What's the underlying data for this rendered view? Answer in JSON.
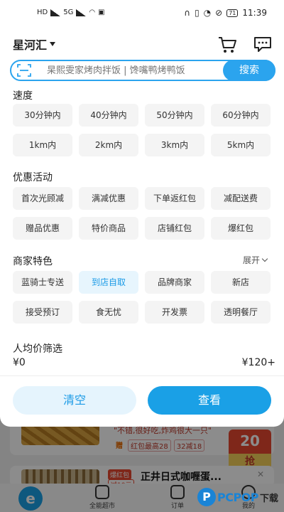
{
  "status_bar": {
    "network": "5G",
    "hd": "HD",
    "battery": "71",
    "time": "11:39"
  },
  "header": {
    "location": "星河汇"
  },
  "search": {
    "placeholder": "杲熙雯家烤肉拌饭 | 馋嘴鸭烤鸭饭",
    "button_label": "搜索"
  },
  "filters": {
    "speed": {
      "title": "速度",
      "options": [
        "30分钟内",
        "40分钟内",
        "50分钟内",
        "60分钟内",
        "1km内",
        "2km内",
        "3km内",
        "5km内"
      ]
    },
    "promotions": {
      "title": "优惠活动",
      "options": [
        "首次光顾减",
        "满减优惠",
        "下单返红包",
        "减配送费",
        "赠品优惠",
        "特价商品",
        "店铺红包",
        "爆红包"
      ]
    },
    "merchant_features": {
      "title": "商家特色",
      "expand_label": "展开",
      "selected": "到店自取",
      "options": [
        "蓝骑士专送",
        "到店自取",
        "品牌商家",
        "新店",
        "接受预订",
        "食无忧",
        "开发票",
        "透明餐厅"
      ]
    },
    "price": {
      "title": "人均价筛选",
      "min": "¥0",
      "max": "¥120+"
    }
  },
  "actions": {
    "clear_label": "清空",
    "view_label": "查看"
  },
  "background_app": {
    "slogan": "\"不错,很好吃,炸鸡很大一只\"",
    "tags": [
      "赠",
      "红包最高28",
      "32减18"
    ],
    "red_packet_amount": "20",
    "red_packet_unit": "红包\n元",
    "red_packet_grab": "抢",
    "badge1": "爆红包",
    "badge2": "减10元",
    "store2_title": "正井日式咖喱蛋...",
    "tabs": [
      "全能超市",
      "订单",
      "我的"
    ]
  },
  "watermark": {
    "logo_letter": "P",
    "text": "PCPOP",
    "suffix": "下载"
  },
  "colors": {
    "accent": "#1aa0e6",
    "accent_light": "#e5f4fd",
    "chip_bg": "#f4f4f4"
  }
}
